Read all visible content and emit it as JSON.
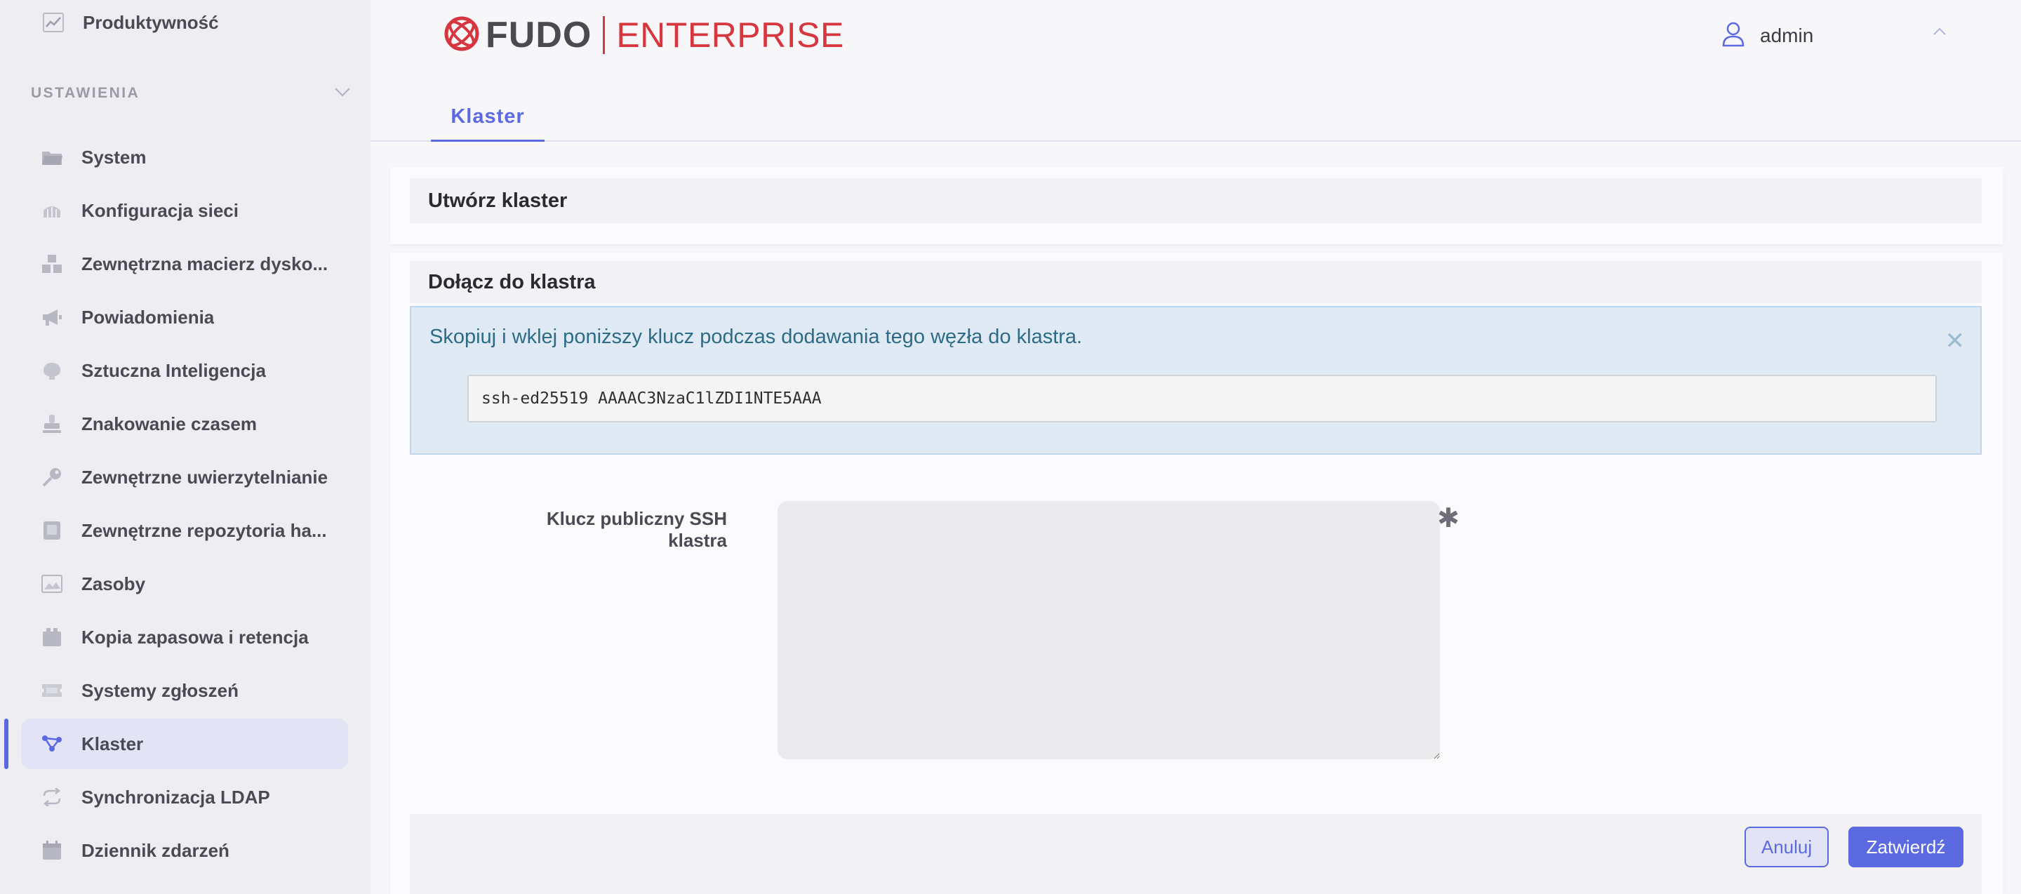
{
  "sidebar": {
    "top_item": {
      "label": "Produktywność",
      "icon": "chart-icon"
    },
    "section_header": "USTAWIENIA",
    "items": [
      {
        "label": "System",
        "icon": "folder-icon"
      },
      {
        "label": "Konfiguracja sieci",
        "icon": "network-icon"
      },
      {
        "label": "Zewnętrzna macierz dysko...",
        "icon": "storage-icon"
      },
      {
        "label": "Powiadomienia",
        "icon": "megaphone-icon"
      },
      {
        "label": "Sztuczna Inteligencja",
        "icon": "brain-icon"
      },
      {
        "label": "Znakowanie czasem",
        "icon": "stamp-icon"
      },
      {
        "label": "Zewnętrzne uwierzytelnianie",
        "icon": "key-icon"
      },
      {
        "label": "Zewnętrzne repozytoria ha...",
        "icon": "vault-icon"
      },
      {
        "label": "Zasoby",
        "icon": "image-icon"
      },
      {
        "label": "Kopia zapasowa i retencja",
        "icon": "box-icon"
      },
      {
        "label": "Systemy zgłoszeń",
        "icon": "ticket-icon"
      },
      {
        "label": "Klaster",
        "icon": "cluster-icon",
        "active": true
      },
      {
        "label": "Synchronizacja LDAP",
        "icon": "sync-icon"
      },
      {
        "label": "Dziennik zdarzeń",
        "icon": "calendar-icon"
      }
    ]
  },
  "header": {
    "logo": {
      "brand": "FUDO",
      "product": "ENTERPRISE"
    },
    "user": {
      "name": "admin",
      "icon": "user-icon"
    }
  },
  "tabs": [
    {
      "label": "Klaster",
      "active": true
    }
  ],
  "create_cluster": {
    "title": "Utwórz klaster"
  },
  "join_cluster": {
    "title": "Dołącz do klastra",
    "alert": {
      "message": "Skopiuj i wklej poniższy klucz podczas dodawania tego węzła do klastra.",
      "key_value": "ssh-ed25519 AAAAC3NzaC1lZDI1NTE5AAA"
    },
    "form": {
      "ssh_key_label": "Klucz publiczny SSH klastra",
      "ssh_key_value": "",
      "required_mark": "✱"
    },
    "buttons": {
      "cancel": "Anuluj",
      "submit": "Zatwierdź"
    }
  },
  "colors": {
    "accent": "#5b6ae0",
    "brand_red": "#d6363e",
    "alert_text": "#2d6b86",
    "alert_bg": "#dfeaf4"
  }
}
